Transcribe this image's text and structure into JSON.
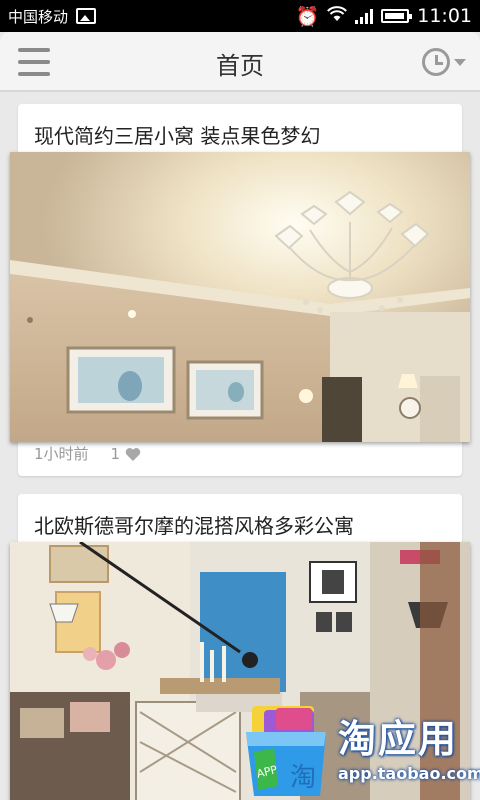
{
  "status_bar": {
    "carrier": "中国移动",
    "time": "11:01",
    "icons": [
      "gallery-icon",
      "alarm-icon",
      "wifi-icon",
      "signal-icon",
      "battery-icon"
    ]
  },
  "app_bar": {
    "title": "首页",
    "menu_icon": "hamburger-menu-icon",
    "history_icon": "clock-dropdown-icon"
  },
  "feed": [
    {
      "title": "现代简约三居小窝 装点果色梦幻",
      "time_ago": "1小时前",
      "likes": "1",
      "image": "living room with crystal chandelier and framed pictures"
    },
    {
      "title": "北欧斯德哥尔摩的混搭风格多彩公寓",
      "image": "colorful Scandinavian living room with floor lamp and artwork"
    }
  ],
  "watermark": {
    "brand": "淘应用",
    "url": "app.taobao.com"
  },
  "colors": {
    "background": "#e9e9e9",
    "appbar": "#f4f4f4",
    "card": "#ffffff",
    "icon_gray": "#9a9a9a",
    "watermark_blue": "#1a4fa0"
  }
}
